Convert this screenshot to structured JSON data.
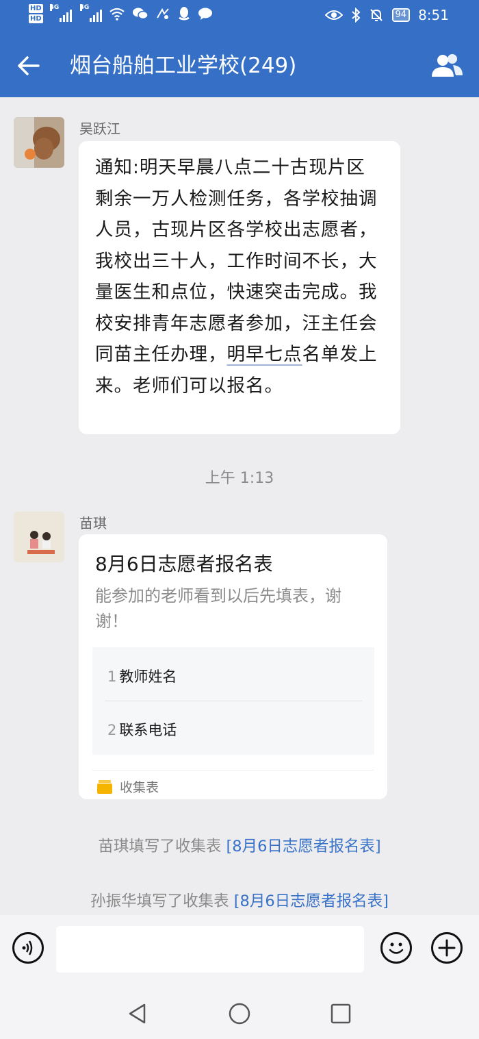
{
  "status_bar": {
    "hd1": "HD",
    "hd2": "HD",
    "net1": "4G",
    "net2": "4G",
    "battery": "94",
    "time": "8:51",
    "icons": [
      "wifi-icon",
      "wechat-icon",
      "app-icon",
      "qq-icon",
      "message-icon",
      "eye-icon",
      "bluetooth-icon",
      "mute-icon"
    ]
  },
  "header": {
    "title": "烟台船舶工业学校(249)",
    "back_icon": "back-arrow-icon",
    "members_icon": "group-members-icon",
    "color": "#3670C6"
  },
  "messages": [
    {
      "sender": "吴跃江",
      "text_before": "通知:明天早晨八点二十古现片区剩余一万人检测任务，各学校抽调人员，古现片区各学校出志愿者，我校出三十人，工作时间不长，大量医生和点位，快速突击完成。我校安排青年志愿者参加，汪主任会同苗主任办理，",
      "text_link": "明早七点",
      "text_after": "名单发上来。老师们可以报名。"
    }
  ],
  "timestamp": "上午 1:13",
  "card": {
    "sender": "苗琪",
    "title": "8月6日志愿者报名表",
    "desc": "能参加的老师看到以后先填表，谢谢！",
    "fields": [
      {
        "num": "1",
        "label": "教师姓名"
      },
      {
        "num": "2",
        "label": "联系电话"
      }
    ],
    "type_label": "收集表",
    "type_icon": "folder-icon"
  },
  "system_msgs": [
    {
      "text": "苗琪填写了收集表 ",
      "link": "[8月6日志愿者报名表]"
    },
    {
      "text": "孙振华填写了收集表 ",
      "link": "[8月6日志愿者报名表]"
    }
  ],
  "input_bar": {
    "voice_icon": "voice-icon",
    "emoji_icon": "emoji-icon",
    "plus_icon": "plus-icon",
    "input_value": ""
  },
  "nav_bar": {
    "back": "nav-back-icon",
    "home": "nav-home-icon",
    "recents": "nav-recents-icon"
  }
}
